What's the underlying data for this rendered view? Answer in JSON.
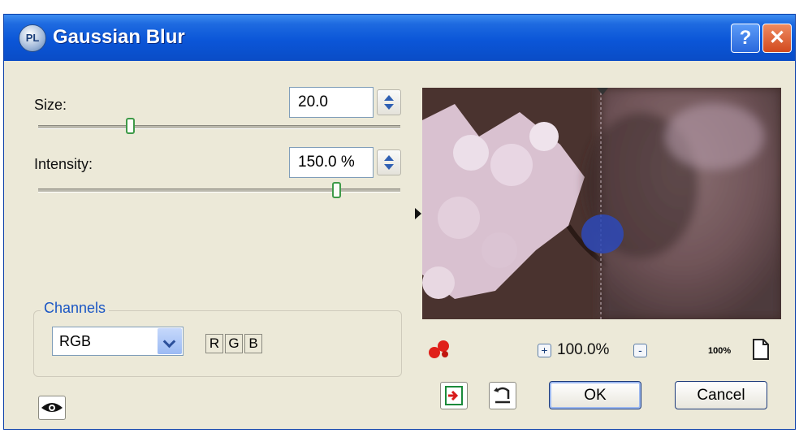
{
  "window": {
    "title": "Gaussian Blur",
    "app_badge": "PL"
  },
  "titlebar": {
    "help_label": "?",
    "close_label": "✕"
  },
  "size": {
    "label": "Size:",
    "value": "20.0"
  },
  "intensity": {
    "label": "Intensity:",
    "value": "150.0 %"
  },
  "channels": {
    "legend": "Channels",
    "selected": "RGB",
    "buttons": [
      "R",
      "G",
      "B"
    ]
  },
  "preview": {
    "zoom_value": "100.0%",
    "zoom_in_label": "+",
    "zoom_out_label": "-",
    "actual_size_label": "100%"
  },
  "footer": {
    "ok_label": "OK",
    "cancel_label": "Cancel"
  },
  "icons": {
    "eye": "eye-icon",
    "help": "help-icon",
    "close": "close-icon",
    "spin": "spin-arrows-icon",
    "dropdown": "chevron-down-icon",
    "pan": "pan-icon",
    "zoom_in": "zoom-in-icon",
    "zoom_out": "zoom-out-icon",
    "fit": "page-icon",
    "randomize": "randomize-icon",
    "reset": "reset-icon"
  }
}
